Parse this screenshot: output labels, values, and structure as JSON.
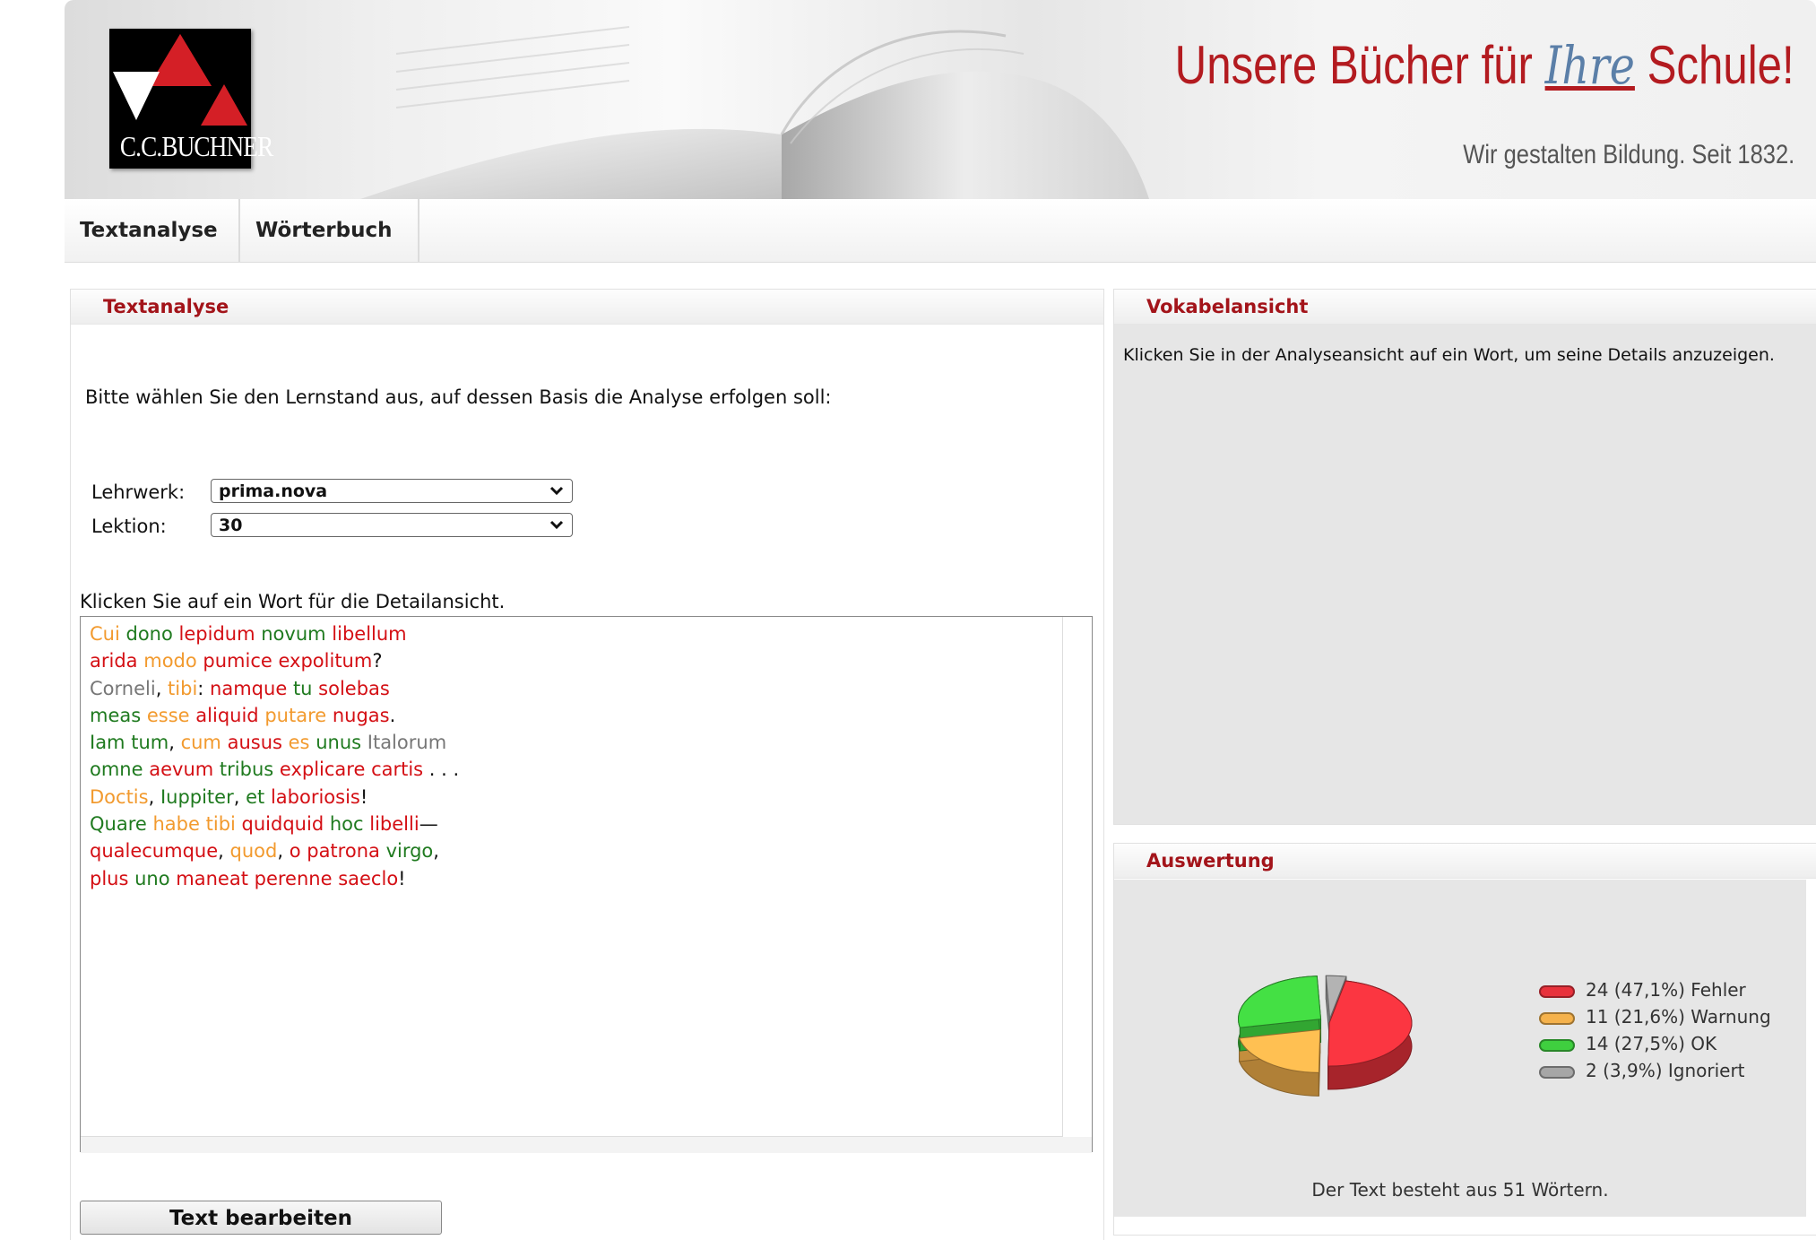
{
  "header": {
    "logo_text": "C.C.BUCHNER",
    "slogan_pre": "Unsere Bücher für",
    "slogan_hand": "Ihre",
    "slogan_post": "Schule!",
    "tagline": "Wir gestalten Bildung. Seit 1832."
  },
  "nav": {
    "tabs": [
      {
        "label": "Textanalyse"
      },
      {
        "label": "Wörterbuch"
      }
    ]
  },
  "left": {
    "title": "Textanalyse",
    "intro": "Bitte wählen Sie den Lernstand aus, auf dessen Basis die Analyse erfolgen soll:",
    "lehrwerk_label": "Lehrwerk:",
    "lehrwerk_value": "prima.nova",
    "lektion_label": "Lektion:",
    "lektion_value": "30",
    "hint": "Klicken Sie auf ein Wort für die Detailansicht.",
    "lines": [
      [
        [
          "Cui",
          "orange"
        ],
        [
          " ",
          ""
        ],
        [
          "dono",
          "green"
        ],
        [
          " ",
          ""
        ],
        [
          "lepidum",
          "red"
        ],
        [
          " ",
          ""
        ],
        [
          "novum",
          "green"
        ],
        [
          " ",
          ""
        ],
        [
          "libellum",
          "red"
        ]
      ],
      [
        [
          "arida",
          "red"
        ],
        [
          " ",
          ""
        ],
        [
          "modo",
          "orange"
        ],
        [
          " ",
          ""
        ],
        [
          "pumice",
          "red"
        ],
        [
          " ",
          ""
        ],
        [
          "expolitum",
          "red"
        ],
        [
          "?",
          "p"
        ]
      ],
      [
        [
          "Corneli",
          "gray"
        ],
        [
          ", ",
          "p"
        ],
        [
          "tibi",
          "orange"
        ],
        [
          ": ",
          "p"
        ],
        [
          "namque",
          "red"
        ],
        [
          " ",
          ""
        ],
        [
          "tu",
          "green"
        ],
        [
          " ",
          ""
        ],
        [
          "solebas",
          "red"
        ]
      ],
      [
        [
          "meas",
          "green"
        ],
        [
          " ",
          ""
        ],
        [
          "esse",
          "orange"
        ],
        [
          " ",
          ""
        ],
        [
          "aliquid",
          "red"
        ],
        [
          " ",
          ""
        ],
        [
          "putare",
          "orange"
        ],
        [
          " ",
          ""
        ],
        [
          "nugas",
          "red"
        ],
        [
          ".",
          "p"
        ]
      ],
      [
        [
          "Iam",
          "green"
        ],
        [
          " ",
          ""
        ],
        [
          "tum",
          "green"
        ],
        [
          ", ",
          "p"
        ],
        [
          "cum",
          "orange"
        ],
        [
          " ",
          ""
        ],
        [
          "ausus",
          "red"
        ],
        [
          " ",
          ""
        ],
        [
          "es",
          "orange"
        ],
        [
          " ",
          ""
        ],
        [
          "unus",
          "green"
        ],
        [
          " ",
          ""
        ],
        [
          "Italorum",
          "gray"
        ]
      ],
      [
        [
          "omne",
          "green"
        ],
        [
          " ",
          ""
        ],
        [
          "aevum",
          "red"
        ],
        [
          " ",
          ""
        ],
        [
          "tribus",
          "green"
        ],
        [
          " ",
          ""
        ],
        [
          "explicare",
          "red"
        ],
        [
          " ",
          ""
        ],
        [
          "cartis",
          "red"
        ],
        [
          " . . .",
          "p"
        ]
      ],
      [
        [
          "Doctis",
          "orange"
        ],
        [
          ", ",
          "p"
        ],
        [
          "Iuppiter",
          "green"
        ],
        [
          ", ",
          "p"
        ],
        [
          "et",
          "green"
        ],
        [
          " ",
          ""
        ],
        [
          "laboriosis",
          "red"
        ],
        [
          "!",
          "p"
        ]
      ],
      [
        [
          "Quare",
          "green"
        ],
        [
          " ",
          ""
        ],
        [
          "habe",
          "orange"
        ],
        [
          " ",
          ""
        ],
        [
          "tibi",
          "orange"
        ],
        [
          " ",
          ""
        ],
        [
          "quidquid",
          "red"
        ],
        [
          " ",
          ""
        ],
        [
          "hoc",
          "green"
        ],
        [
          " ",
          ""
        ],
        [
          "libelli",
          "red"
        ],
        [
          "—",
          "p"
        ]
      ],
      [
        [
          "qualecumque",
          "red"
        ],
        [
          ", ",
          "p"
        ],
        [
          "quod",
          "orange"
        ],
        [
          ", ",
          "p"
        ],
        [
          "o",
          "red"
        ],
        [
          " ",
          ""
        ],
        [
          "patrona",
          "red"
        ],
        [
          " ",
          ""
        ],
        [
          "virgo",
          "green"
        ],
        [
          ",",
          "p"
        ]
      ],
      [
        [
          "plus",
          "red"
        ],
        [
          " ",
          ""
        ],
        [
          "uno",
          "green"
        ],
        [
          " ",
          ""
        ],
        [
          "maneat",
          "red"
        ],
        [
          " ",
          ""
        ],
        [
          "perenne",
          "red"
        ],
        [
          " ",
          ""
        ],
        [
          "saeclo",
          "red"
        ],
        [
          "!",
          "p"
        ]
      ]
    ],
    "edit_button": "Text bearbeiten"
  },
  "vokabel": {
    "title": "Vokabelansicht",
    "message": "Klicken Sie in der Analyseansicht auf ein Wort, um seine Details anzuzeigen."
  },
  "auswertung": {
    "title": "Auswertung",
    "legend": [
      {
        "label": "24 (47,1%) Fehler",
        "color": "#e8323c"
      },
      {
        "label": "11 (21,6%) Warnung",
        "color": "#f5b24c"
      },
      {
        "label": "14 (27,5%) OK",
        "color": "#3fcf3f"
      },
      {
        "label": "2 (3,9%) Ignoriert",
        "color": "#a6a6a6"
      }
    ],
    "summary": "Der Text besteht aus 51 Wörtern."
  },
  "chart_data": {
    "type": "pie",
    "categories": [
      "Fehler",
      "Warnung",
      "OK",
      "Ignoriert"
    ],
    "values": [
      24,
      11,
      14,
      2
    ],
    "percentages": [
      47.1,
      21.6,
      27.5,
      3.9
    ],
    "colors": [
      "#e8323c",
      "#f5b24c",
      "#3fcf3f",
      "#a6a6a6"
    ],
    "legend_position": "right"
  }
}
